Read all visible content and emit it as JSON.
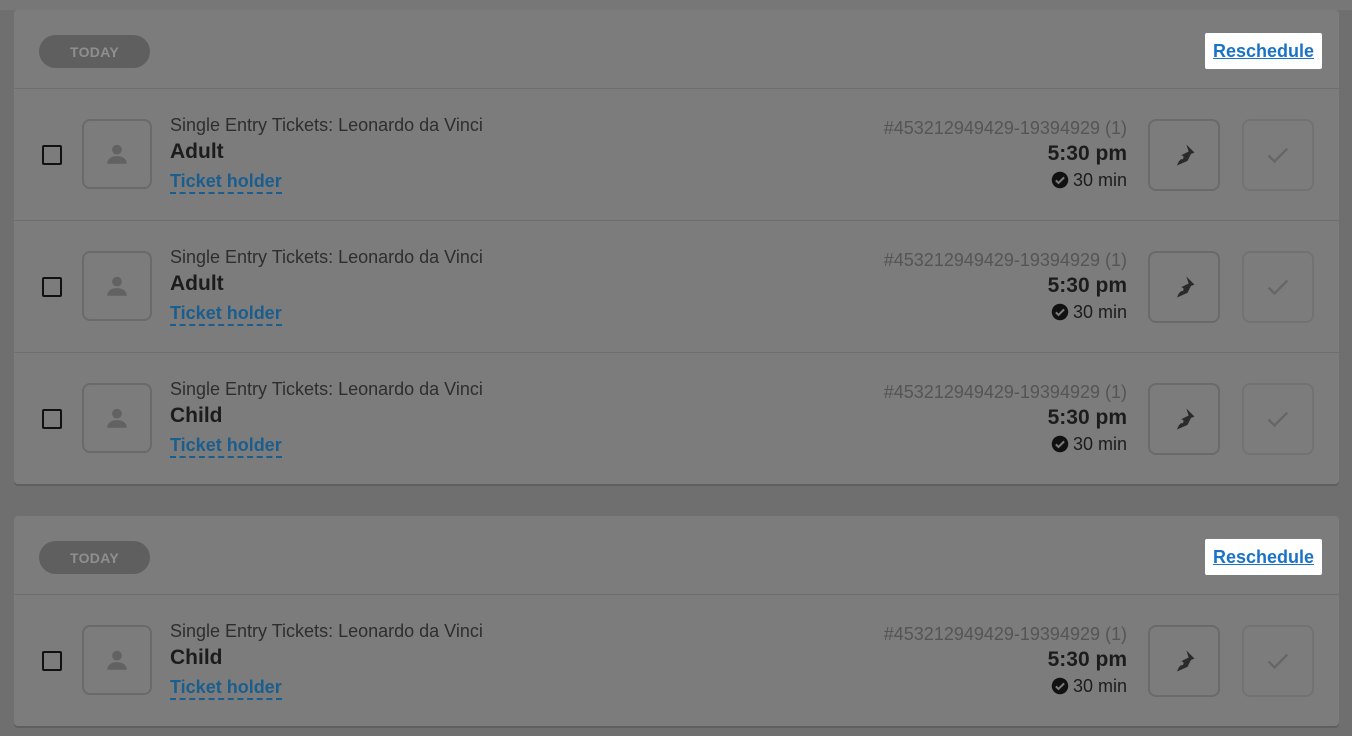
{
  "groups": [
    {
      "date_label": "TODAY",
      "reschedule_label": "Reschedule",
      "tickets": [
        {
          "title": "Single Entry Tickets: Leonardo da Vinci",
          "type": "Adult",
          "holder_label": "Ticket holder",
          "order_id": "#453212949429-19394929 (1)",
          "time": "5:30 pm",
          "duration": "30 min"
        },
        {
          "title": "Single Entry Tickets: Leonardo da Vinci",
          "type": "Adult",
          "holder_label": "Ticket holder",
          "order_id": "#453212949429-19394929 (1)",
          "time": "5:30 pm",
          "duration": "30 min"
        },
        {
          "title": "Single Entry Tickets: Leonardo da Vinci",
          "type": "Child",
          "holder_label": "Ticket holder",
          "order_id": "#453212949429-19394929 (1)",
          "time": "5:30 pm",
          "duration": "30 min"
        }
      ]
    },
    {
      "date_label": "TODAY",
      "reschedule_label": "Reschedule",
      "tickets": [
        {
          "title": "Single Entry Tickets: Leonardo da Vinci",
          "type": "Child",
          "holder_label": "Ticket holder",
          "order_id": "#453212949429-19394929 (1)",
          "time": "5:30 pm",
          "duration": "30 min"
        }
      ]
    }
  ],
  "icons": {
    "avatar": "person-icon",
    "sign": "pen-nib-icon",
    "check_in": "checkmark-icon",
    "duration": "check-circle-icon"
  },
  "colors": {
    "overlay_bg": "#6f6f6f",
    "reschedule_link": "#1a73c7",
    "holder_link": "#1b5e8e"
  }
}
